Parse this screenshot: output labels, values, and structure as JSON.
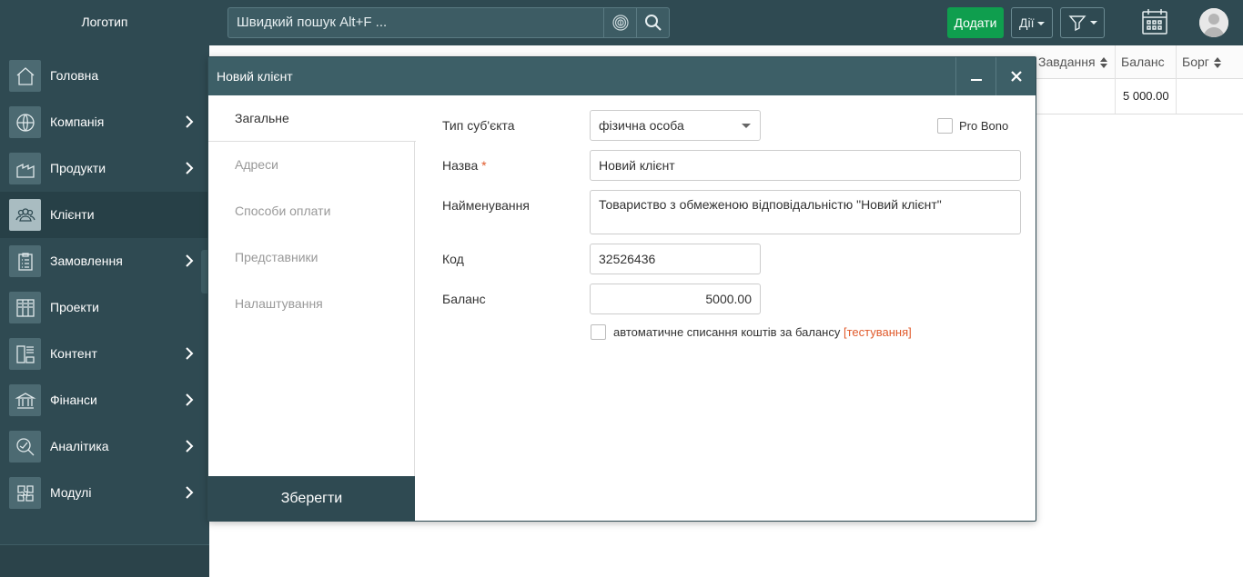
{
  "app": {
    "logo_text": "Логотип"
  },
  "search": {
    "placeholder": "Швидкий пошук Alt+F ..."
  },
  "toolbar": {
    "add_label": "Додати",
    "actions_label": "Дії"
  },
  "sidebar": {
    "items": [
      {
        "label": "Головна",
        "icon": "home-icon",
        "has_submenu": false
      },
      {
        "label": "Компанія",
        "icon": "globe-icon",
        "has_submenu": true
      },
      {
        "label": "Продукти",
        "icon": "products-icon",
        "has_submenu": true
      },
      {
        "label": "Клієнти",
        "icon": "users-icon",
        "has_submenu": false,
        "active": true
      },
      {
        "label": "Замовлення",
        "icon": "clipboard-icon",
        "has_submenu": true
      },
      {
        "label": "Проекти",
        "icon": "kanban-icon",
        "has_submenu": false
      },
      {
        "label": "Контент",
        "icon": "content-icon",
        "has_submenu": true
      },
      {
        "label": "Фінанси",
        "icon": "bank-icon",
        "has_submenu": true
      },
      {
        "label": "Аналітика",
        "icon": "analytics-icon",
        "has_submenu": true
      },
      {
        "label": "Модулі",
        "icon": "puzzle-icon",
        "has_submenu": true
      }
    ]
  },
  "table": {
    "headers": [
      "Завдання",
      "Баланс",
      "Борг"
    ],
    "row": {
      "balance": "5 000.00"
    }
  },
  "modal": {
    "title": "Новий клієнт",
    "tabs": [
      "Загальне",
      "Адреси",
      "Способи оплати",
      "Представники",
      "Налаштування"
    ],
    "active_tab": "Загальне",
    "save_label": "Зберегти",
    "fields": {
      "subject_type_label": "Тип суб'єкта",
      "subject_type_value": "фізична особа",
      "pro_bono_label": "Pro Bono",
      "pro_bono_checked": false,
      "name_label": "Назва",
      "name_required": "*",
      "name_value": "Новий клієнт",
      "fullname_label": "Найменування",
      "fullname_value": "Товариство з обмеженою відповідальністю \"Новий клієнт\"",
      "code_label": "Код",
      "code_value": "32526436",
      "balance_label": "Баланс",
      "balance_value": "5000.00",
      "auto_debit_label": "автоматичне списання коштів за балансу",
      "auto_debit_note": "[тестування]",
      "auto_debit_checked": false
    }
  },
  "colors": {
    "sidebar_bg": "#2f4a52",
    "add_button": "#0f9e4e",
    "warning": "#e05a2b"
  }
}
